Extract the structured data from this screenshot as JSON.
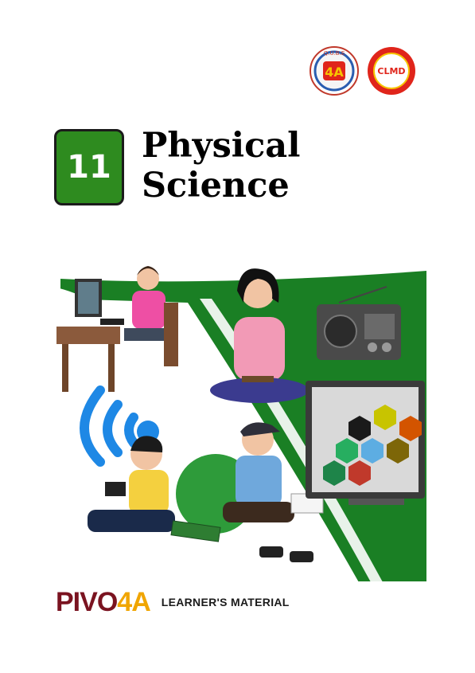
{
  "logos": {
    "left_seal_text": "Q.U.B.E",
    "right_seal_text": "CLMD"
  },
  "grade_badge": {
    "number": "11"
  },
  "title": {
    "line1": "Physical",
    "line2": "Science"
  },
  "brand": {
    "logo_prefix": "PIV",
    "logo_mid": "O",
    "logo_num": "4",
    "logo_suffix": "A",
    "tagline": "LEARNER'S MATERIAL"
  },
  "colors": {
    "green": "#2e8b1f",
    "maroon": "#7a1320",
    "gold": "#f0a500",
    "clmd_red": "#e0251b"
  },
  "icons": [
    "wifi-signal-icon",
    "radio-icon",
    "computer-icon",
    "tv-icon",
    "atom-icon"
  ]
}
